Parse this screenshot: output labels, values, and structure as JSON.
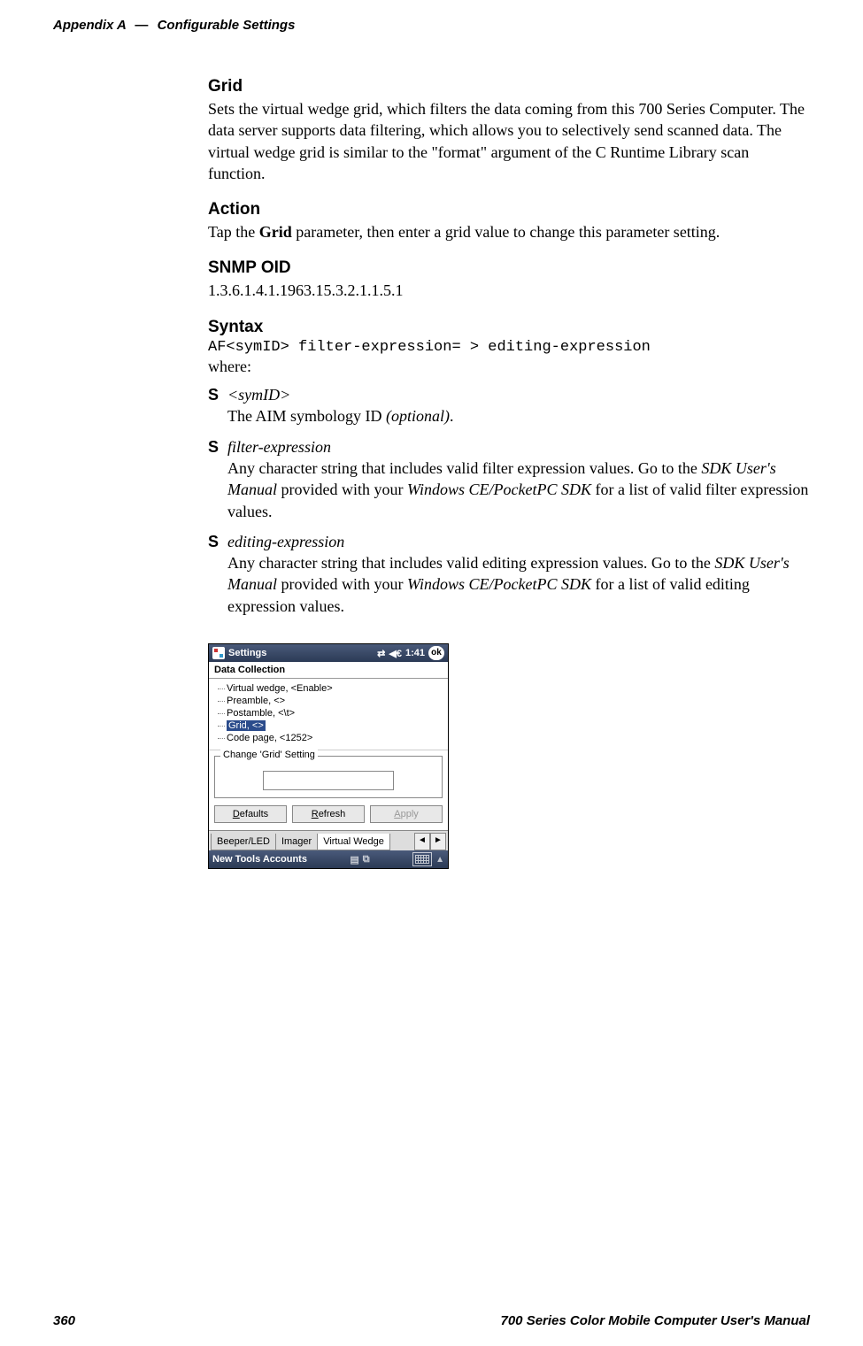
{
  "header": {
    "appendix": "Appendix A",
    "dash": "—",
    "title": "Configurable Settings"
  },
  "sections": {
    "grid_h": "Grid",
    "grid_body": "Sets the virtual wedge grid, which filters the data coming from this 700 Series Computer. The data server supports data filtering, which allows you to selectively send scanned data. The virtual wedge grid is similar to the \"format\" argument of the C Runtime Library scan function.",
    "action_h": "Action",
    "action_pre": "Tap the ",
    "action_bold": "Grid",
    "action_post": " parameter, then enter a grid value to change this parameter setting.",
    "snmp_h": "SNMP OID",
    "snmp_val": "1.3.6.1.4.1.1963.15.3.2.1.1.5.1",
    "syntax_h": "Syntax",
    "syntax_code": "AF<symID> filter-expression= > editing-expression",
    "syntax_where": "where:",
    "bul1_term": "<symID>",
    "bul1_body_a": "The AIM symbology ID ",
    "bul1_body_b": "(optional)",
    "bul1_body_c": ".",
    "bul2_term": "filter-expression",
    "bul2_body_a": "Any character string that includes valid filter expression values. Go to the ",
    "bul2_body_b": "SDK User's Manual",
    "bul2_body_c": " provided with your ",
    "bul2_body_d": "Windows CE/PocketPC SDK",
    "bul2_body_e": " for a list of valid filter expression values.",
    "bul3_term": "editing-expression",
    "bul3_body_a": "Any character string that includes valid editing expression values. Go to the ",
    "bul3_body_b": "SDK User's Manual",
    "bul3_body_c": " provided with your ",
    "bul3_body_d": "Windows CE/PocketPC SDK",
    "bul3_body_e": " for a list of valid editing expression values."
  },
  "screenshot": {
    "title": "Settings",
    "time": "1:41",
    "ok": "ok",
    "subtitle": "Data Collection",
    "tree": {
      "i0": "Virtual wedge, <Enable>",
      "i1": "Preamble, <>",
      "i2": "Postamble, <\\t>",
      "i3": "Grid, <>",
      "i4": "Code page, <1252>"
    },
    "group_legend": "Change 'Grid' Setting",
    "input_value": "",
    "buttons": {
      "defaults_pre": "D",
      "defaults_rest": "efaults",
      "refresh_pre": "R",
      "refresh_rest": "efresh",
      "apply_pre": "A",
      "apply_rest": "pply"
    },
    "tabs": {
      "t0": "Beeper/LED",
      "t1": "Imager",
      "t2": "Virtual Wedge",
      "left": "◄",
      "right": "►"
    },
    "bottom": {
      "menu": "New Tools Accounts",
      "caret": "▲"
    }
  },
  "footer": {
    "page": "360",
    "manual": "700 Series Color Mobile Computer User's Manual"
  }
}
